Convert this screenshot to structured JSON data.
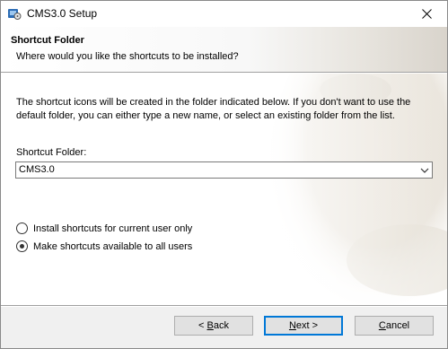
{
  "window": {
    "title": "CMS3.0 Setup"
  },
  "header": {
    "title": "Shortcut Folder",
    "subtitle": "Where would you like the shortcuts to be installed?"
  },
  "content": {
    "description": "The shortcut icons will be created in the folder indicated below. If you don't want to use the default folder, you can either type a new name, or select an existing folder from the list.",
    "folder_label": "Shortcut Folder:",
    "folder_value": "CMS3.0",
    "radio_options": [
      {
        "label": "Install shortcuts for current user only",
        "checked": false
      },
      {
        "label": "Make shortcuts available to all users",
        "checked": true
      }
    ]
  },
  "buttons": {
    "back": {
      "accel": "B",
      "rest": "ack",
      "prefix": "< "
    },
    "next": {
      "accel": "N",
      "rest": "ext >"
    },
    "cancel": {
      "accel": "C",
      "rest": "ancel"
    }
  },
  "icons": {
    "app": "installer-app-icon",
    "close": "close-icon",
    "dropdown": "chevron-down-icon"
  },
  "colors": {
    "accent": "#0078d7",
    "footer_bg": "#f0f0f0",
    "button_bg": "#e1e1e1"
  }
}
